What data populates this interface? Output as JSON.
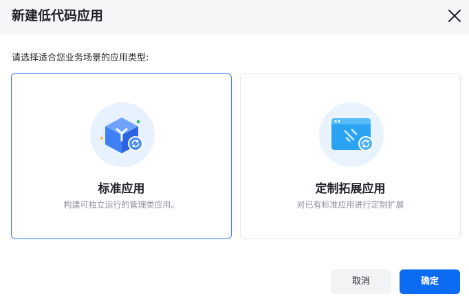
{
  "dialog": {
    "title": "新建低代码应用",
    "close_icon": "close-icon"
  },
  "prompt": "请选择适合您业务场景的应用类型:",
  "cards": [
    {
      "name": "标准应用",
      "description": "构建可独立运行的管理类应用。",
      "icon": "cube-icon",
      "selected": true
    },
    {
      "name": "定制拓展应用",
      "description": "对已有标准应用进行定制扩展",
      "icon": "app-window-icon",
      "selected": false
    }
  ],
  "buttons": {
    "cancel_label": "取消",
    "ok_label": "确定"
  },
  "colors": {
    "accent": "#0b6bf3",
    "selected_border": "#2b6ff2",
    "header_bg": "#f5f6f7"
  }
}
